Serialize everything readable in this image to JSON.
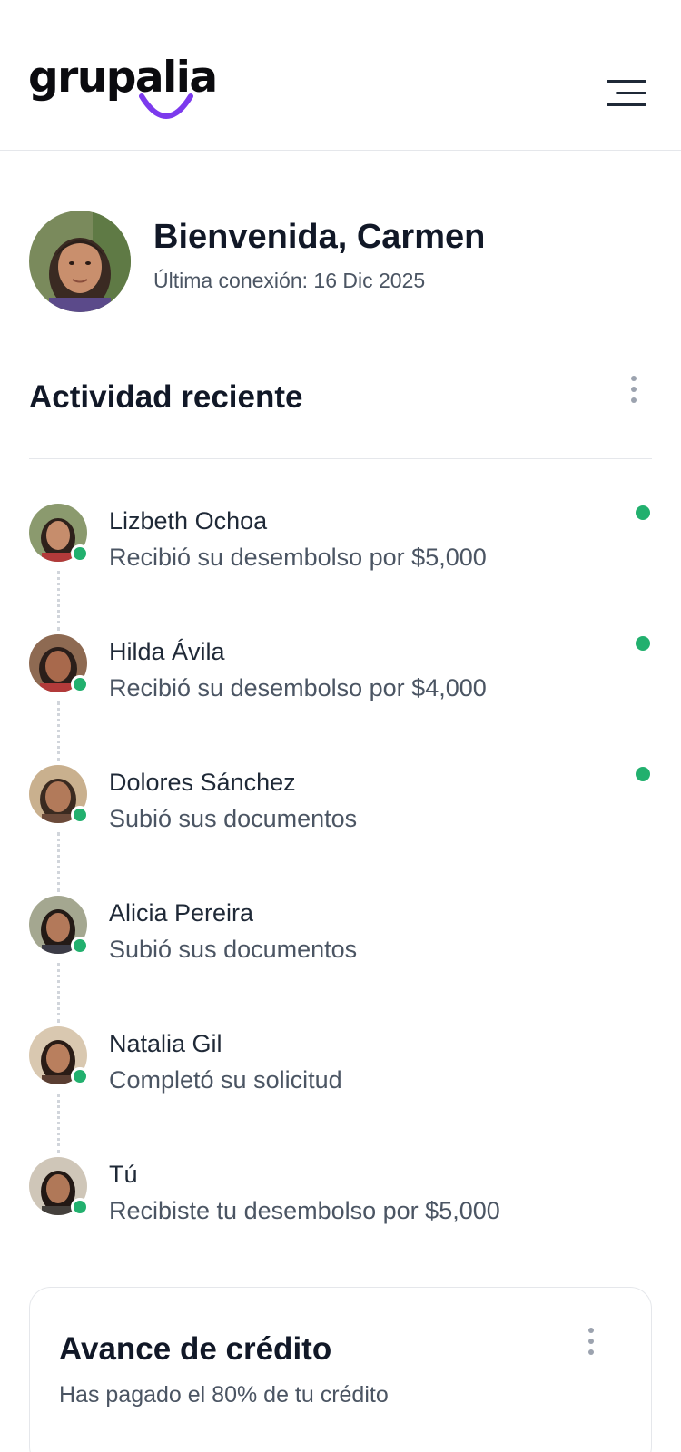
{
  "header": {
    "logo": "grupalia",
    "brand_color": "#7c3aed",
    "menu_icon": "hamburger-menu-icon"
  },
  "welcome": {
    "title": "Bienvenida, Carmen",
    "last_login": "Última conexión: 16 Dic 2025"
  },
  "activity": {
    "title": "Actividad reciente",
    "items": [
      {
        "name": "Lizbeth Ochoa",
        "text": "Recibió su desembolso por $5,000",
        "unread": true
      },
      {
        "name": "Hilda Ávila",
        "text": "Recibió su desembolso por $4,000",
        "unread": true
      },
      {
        "name": "Dolores Sánchez",
        "text": "Subió sus documentos",
        "unread": true
      },
      {
        "name": "Alicia Pereira",
        "text": "Subió sus documentos",
        "unread": false
      },
      {
        "name": "Natalia Gil",
        "text": "Completó su solicitud",
        "unread": false
      },
      {
        "name": "Tú",
        "text": "Recibiste tu desembolso por $5,000",
        "unread": false
      }
    ]
  },
  "credit_card": {
    "title": "Avance de crédito",
    "subtitle": "Has pagado el 80% de tu crédito",
    "paid_percent": 80
  },
  "colors": {
    "online": "#22b06e",
    "text_primary": "#111827",
    "text_secondary": "#4b5563",
    "divider": "#e5e7eb"
  }
}
